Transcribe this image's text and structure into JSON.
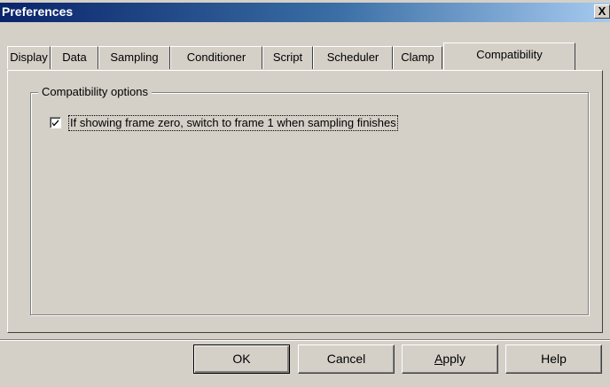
{
  "window": {
    "title": "Preferences",
    "close_label": "X"
  },
  "tabs": [
    {
      "label": "Display"
    },
    {
      "label": "Data"
    },
    {
      "label": "Sampling"
    },
    {
      "label": "Conditioner"
    },
    {
      "label": "Script"
    },
    {
      "label": "Scheduler"
    },
    {
      "label": "Clamp"
    },
    {
      "label": "Compatibility",
      "active": true
    }
  ],
  "group": {
    "label": "Compatibility options",
    "option": {
      "label": "If showing frame zero, switch to frame 1 when sampling finishes",
      "checked": true
    }
  },
  "buttons": {
    "ok": "OK",
    "cancel": "Cancel",
    "apply_underlined": "A",
    "apply_rest": "pply",
    "help": "Help"
  }
}
